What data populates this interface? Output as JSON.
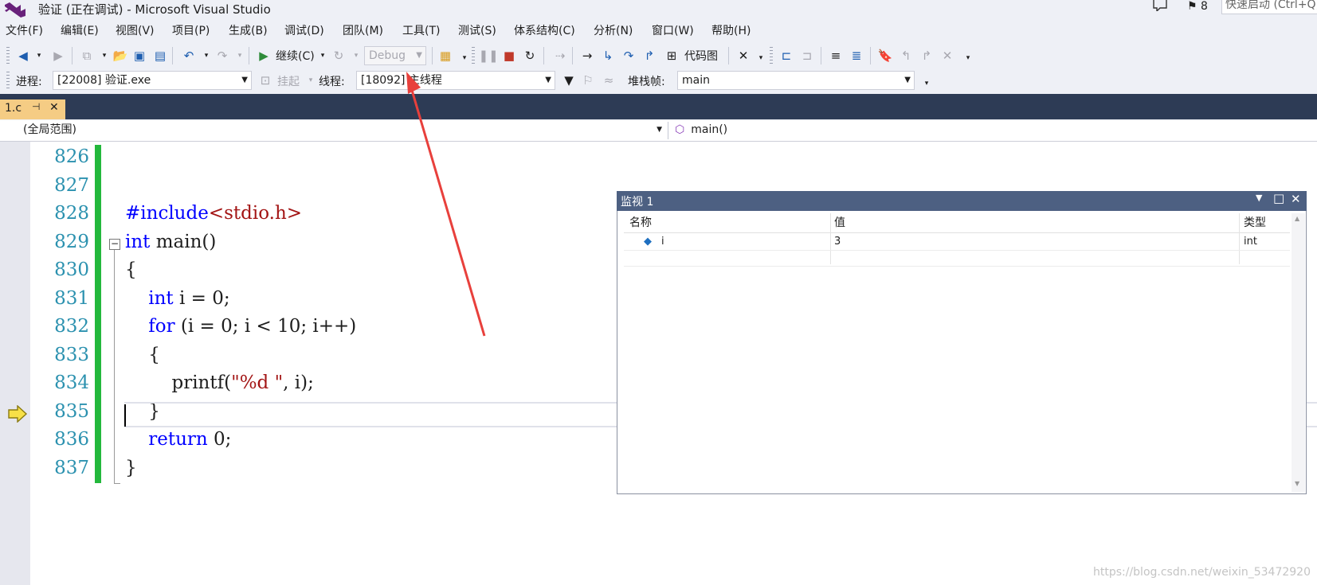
{
  "title": "验证 (正在调试) - Microsoft Visual Studio",
  "notifications_count": "8",
  "quick_launch_placeholder": "快速启动 (Ctrl+Q)",
  "menu": [
    "文件(F)",
    "编辑(E)",
    "视图(V)",
    "项目(P)",
    "生成(B)",
    "调试(D)",
    "团队(M)",
    "工具(T)",
    "测试(S)",
    "体系结构(C)",
    "分析(N)",
    "窗口(W)",
    "帮助(H)"
  ],
  "toolbar": {
    "continue_label": "继续(C)",
    "config_value": "Debug",
    "code_map_label": "代码图"
  },
  "debug_location": {
    "process_label": "进程:",
    "process_value": "[22008] 验证.exe",
    "suspend_label": "挂起",
    "thread_label": "线程:",
    "thread_value": "[18092] 主线程",
    "stack_label": "堆栈帧:",
    "stack_value": "main"
  },
  "tab": {
    "label": "1.c",
    "pin": "⊣",
    "close": "✕"
  },
  "nav": {
    "scope": "(全局范围)",
    "member": "main()"
  },
  "code": {
    "lines": [
      {
        "no": "826",
        "text": ""
      },
      {
        "no": "827",
        "text": ""
      },
      {
        "no": "828",
        "text": "#include<stdio.h>"
      },
      {
        "no": "829",
        "text": "int main()"
      },
      {
        "no": "830",
        "text": "{"
      },
      {
        "no": "831",
        "text": "    int i = 0;"
      },
      {
        "no": "832",
        "text": "    for (i = 0; i < 10; i++)"
      },
      {
        "no": "833",
        "text": "    {"
      },
      {
        "no": "834",
        "text": "        printf(\"%d \", i);"
      },
      {
        "no": "835",
        "text": "    }"
      },
      {
        "no": "836",
        "text": "    return 0;"
      },
      {
        "no": "837",
        "text": "}"
      }
    ],
    "current_line": "835"
  },
  "watch": {
    "title": "监视 1",
    "columns": [
      "名称",
      "值",
      "类型"
    ],
    "rows": [
      {
        "name": "i",
        "value": "3",
        "type": "int"
      }
    ]
  },
  "watermark": "https://blog.csdn.net/weixin_53472920",
  "colors": {
    "accent_tab": "#f5cc84",
    "tabstrip": "#2d3b55",
    "watch_title": "#4d6082",
    "change_bar": "#23b83c",
    "arrow": "#e8403c"
  }
}
